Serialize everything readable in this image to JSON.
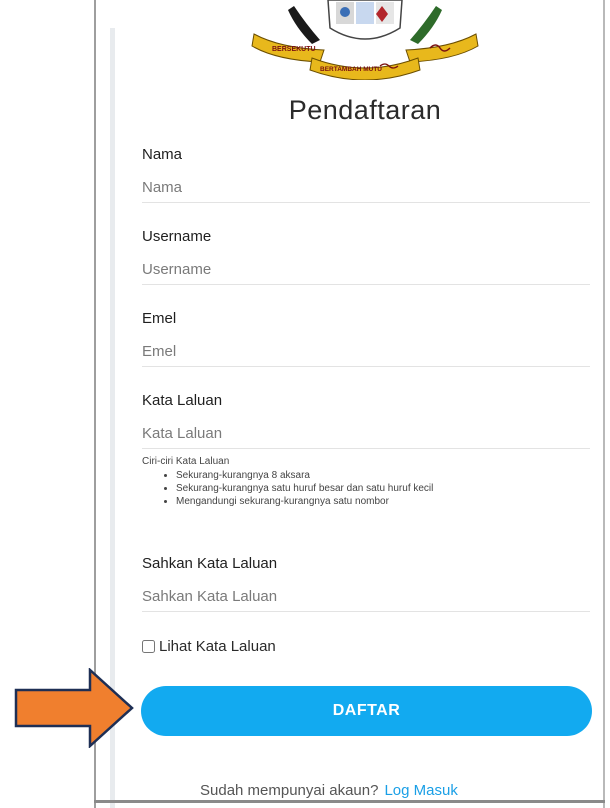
{
  "title": "Pendaftaran",
  "crest": {
    "motto_left": "BERSEKUTU",
    "motto_bottom": "BERTAMBAH MUTU"
  },
  "fields": [
    {
      "label": "Nama",
      "placeholder": "Nama"
    },
    {
      "label": "Username",
      "placeholder": "Username"
    },
    {
      "label": "Emel",
      "placeholder": "Emel"
    },
    {
      "label": "Kata Laluan",
      "placeholder": "Kata Laluan"
    },
    {
      "label": "Sahkan Kata Laluan",
      "placeholder": "Sahkan Kata Laluan"
    }
  ],
  "password_rules": {
    "heading": "Ciri-ciri Kata Laluan",
    "items": [
      "Sekurang-kurangnya 8 aksara",
      "Sekurang-kurangnya satu huruf besar dan satu huruf kecil",
      "Mengandungi sekurang-kurangnya satu nombor"
    ]
  },
  "show_password_label": "Lihat Kata Laluan",
  "submit_label": "DAFTAR",
  "footer": {
    "text": "Sudah mempunyai akaun?",
    "link": "Log Masuk"
  },
  "colors": {
    "button": "#12aaf0",
    "arrow": "#f07f2e",
    "link": "#1a9fe6"
  },
  "icons": [
    "crest-logo-icon",
    "arrow-right-icon",
    "checkbox-icon"
  ]
}
